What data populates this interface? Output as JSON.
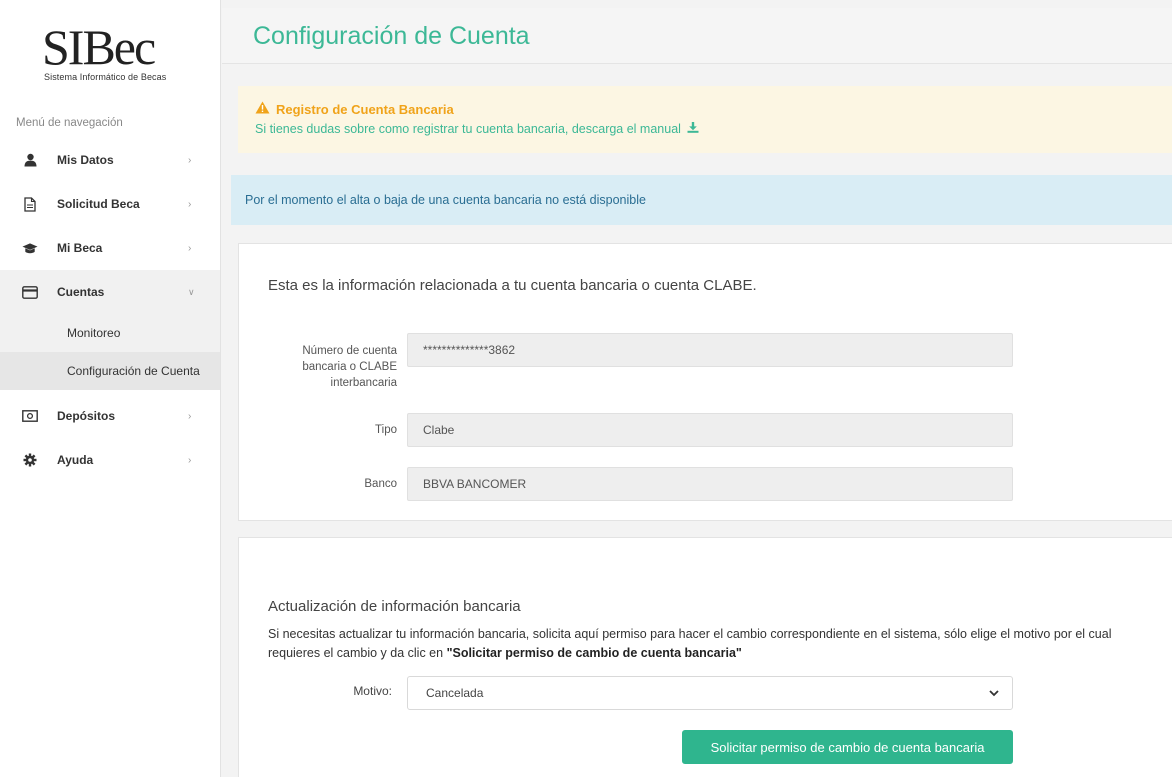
{
  "logo": {
    "text": "SIBec",
    "subtitle": "Sistema Informático de Becas"
  },
  "sidebar": {
    "nav_label": "Menú de navegación",
    "items": [
      {
        "label": "Mis Datos",
        "icon": "user-icon"
      },
      {
        "label": "Solicitud Beca",
        "icon": "document-icon"
      },
      {
        "label": "Mi Beca",
        "icon": "graduation-cap-icon"
      },
      {
        "label": "Cuentas",
        "icon": "credit-card-icon"
      },
      {
        "label": "Depósitos",
        "icon": "money-bill-icon"
      },
      {
        "label": "Ayuda",
        "icon": "gear-icon"
      }
    ],
    "sub_items": [
      {
        "label": "Monitoreo"
      },
      {
        "label": "Configuración de Cuenta"
      }
    ]
  },
  "header": {
    "title": "Configuración de Cuenta"
  },
  "alert_warning": {
    "title": "Registro de Cuenta Bancaria",
    "message": "Si tienes dudas sobre como registrar tu cuenta bancaria, descarga el manual"
  },
  "alert_info": {
    "message": "Por el momento el alta o baja de una cuenta bancaria no está disponible"
  },
  "account_card": {
    "intro": "Esta es la información relacionada a tu cuenta bancaria o cuenta CLABE.",
    "fields": [
      {
        "label": "Número de cuenta bancaria o CLABE interbancaria",
        "value": "**************3862"
      },
      {
        "label": "Tipo",
        "value": "Clabe"
      },
      {
        "label": "Banco",
        "value": "BBVA BANCOMER"
      }
    ]
  },
  "update_card": {
    "heading": "Actualización de información bancaria",
    "paragraph_prefix": "Si necesitas actualizar tu información bancaria, solicita aquí permiso para hacer el cambio correspondiente en el sistema, sólo elige el motivo por el cual requieres el cambio y da clic en ",
    "paragraph_bold": "\"Solicitar permiso de cambio de cuenta bancaria\"",
    "select_label": "Motivo:",
    "select_value": "Cancelada",
    "button_label": "Solicitar permiso de cambio de cuenta bancaria"
  },
  "colors": {
    "accent": "#3cb896",
    "warning": "#f0a31a",
    "info_bg": "#d9edf5",
    "button": "#2fb58e"
  }
}
